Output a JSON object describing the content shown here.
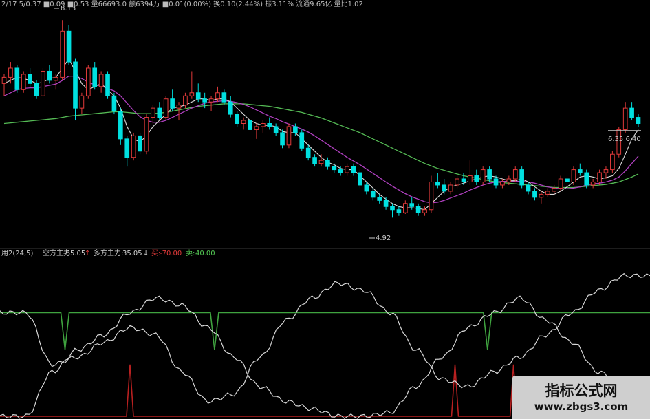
{
  "colors": {
    "up": "#e23a3a",
    "down": "#00e0e0",
    "ma_white": "#dddddd",
    "ma_purple": "#b040c0",
    "ma_green": "#55bb55",
    "ind_white": "#d8d8d8",
    "ind_green": "#3fa33f",
    "ind_red": "#b82020",
    "separator": "#3a3a3a"
  },
  "price_header": {
    "text": "2/17 5/0.37 ■0.09 ■0.53 量66693.0 额6394万 ■0.01(0.00%) 换0.10(2.44%) 振3.11% 流通9.65亿 量比1.02"
  },
  "price_annotations": {
    "high": "8.13",
    "low": "4.92",
    "right_pair": "6.35 6.40"
  },
  "indicator_header": {
    "name": "用2(24,5)",
    "short_label": "空方主力:",
    "short_value": "-65.05",
    "short_arrow": "↑",
    "long_label": "多方主力:",
    "long_value": "35.05",
    "long_arrow": "↓",
    "sell_label": "买:",
    "sell_value": "-70.00",
    "buy_label": "卖:",
    "buy_value": "40.00"
  },
  "watermark": {
    "title": "指标公式网",
    "url": "www.zbgs3.com"
  },
  "chart_data": [
    {
      "type": "candlestick",
      "subtitle": "price panel with moving averages",
      "ylim": [
        4.6,
        8.3
      ],
      "candles": [
        [
          7.1,
          7.25,
          6.9,
          7.2
        ],
        [
          7.2,
          7.45,
          7.1,
          7.35
        ],
        [
          7.35,
          7.4,
          6.95,
          7.0
        ],
        [
          7.0,
          7.3,
          6.95,
          7.25
        ],
        [
          7.25,
          7.35,
          7.05,
          7.1
        ],
        [
          7.1,
          7.15,
          6.85,
          6.9
        ],
        [
          6.9,
          7.35,
          6.9,
          7.3
        ],
        [
          7.3,
          7.4,
          7.1,
          7.15
        ],
        [
          7.15,
          7.25,
          7.0,
          7.2
        ],
        [
          7.2,
          8.13,
          7.15,
          7.95
        ],
        [
          7.95,
          8.05,
          7.4,
          7.45
        ],
        [
          7.45,
          7.5,
          6.5,
          6.7
        ],
        [
          6.7,
          6.95,
          6.6,
          6.9
        ],
        [
          6.9,
          7.4,
          6.85,
          7.35
        ],
        [
          7.35,
          7.45,
          7.0,
          7.05
        ],
        [
          7.05,
          7.3,
          6.95,
          7.25
        ],
        [
          7.25,
          7.3,
          6.85,
          6.9
        ],
        [
          6.9,
          6.95,
          6.6,
          6.65
        ],
        [
          6.65,
          6.7,
          6.1,
          6.2
        ],
        [
          6.2,
          6.25,
          5.75,
          5.9
        ],
        [
          5.9,
          6.3,
          5.85,
          6.25
        ],
        [
          6.25,
          6.3,
          5.95,
          6.0
        ],
        [
          6.0,
          6.6,
          5.95,
          6.55
        ],
        [
          6.55,
          6.75,
          6.45,
          6.7
        ],
        [
          6.7,
          6.8,
          6.5,
          6.55
        ],
        [
          6.55,
          6.9,
          6.5,
          6.85
        ],
        [
          6.85,
          7.0,
          6.65,
          6.7
        ],
        [
          6.7,
          6.8,
          6.5,
          6.75
        ],
        [
          6.75,
          6.95,
          6.7,
          6.9
        ],
        [
          6.9,
          7.3,
          6.85,
          6.95
        ],
        [
          6.95,
          7.1,
          6.8,
          6.85
        ],
        [
          6.85,
          6.95,
          6.7,
          6.8
        ],
        [
          6.8,
          6.9,
          6.65,
          6.85
        ],
        [
          6.85,
          7.05,
          6.8,
          6.95
        ],
        [
          6.95,
          7.0,
          6.75,
          6.8
        ],
        [
          6.8,
          6.9,
          6.55,
          6.6
        ],
        [
          6.6,
          6.65,
          6.4,
          6.45
        ],
        [
          6.45,
          6.55,
          6.35,
          6.5
        ],
        [
          6.5,
          6.55,
          6.3,
          6.35
        ],
        [
          6.35,
          6.45,
          6.2,
          6.4
        ],
        [
          6.4,
          6.5,
          6.3,
          6.45
        ],
        [
          6.45,
          6.55,
          6.35,
          6.4
        ],
        [
          6.4,
          6.45,
          6.25,
          6.3
        ],
        [
          6.3,
          6.35,
          6.05,
          6.1
        ],
        [
          6.1,
          6.45,
          6.05,
          6.4
        ],
        [
          6.4,
          6.45,
          6.25,
          6.3
        ],
        [
          6.3,
          6.35,
          6.0,
          6.05
        ],
        [
          6.05,
          6.1,
          5.85,
          5.9
        ],
        [
          5.9,
          5.95,
          5.75,
          5.8
        ],
        [
          5.8,
          5.95,
          5.75,
          5.85
        ],
        [
          5.85,
          5.9,
          5.7,
          5.75
        ],
        [
          5.75,
          5.8,
          5.65,
          5.7
        ],
        [
          5.7,
          5.75,
          5.6,
          5.65
        ],
        [
          5.65,
          5.8,
          5.6,
          5.75
        ],
        [
          5.75,
          5.8,
          5.6,
          5.65
        ],
        [
          5.65,
          5.7,
          5.4,
          5.45
        ],
        [
          5.45,
          5.5,
          5.3,
          5.35
        ],
        [
          5.35,
          5.4,
          5.2,
          5.25
        ],
        [
          5.25,
          5.3,
          5.15,
          5.2
        ],
        [
          5.2,
          5.25,
          5.05,
          5.1
        ],
        [
          5.1,
          5.15,
          4.92,
          5.05
        ],
        [
          5.05,
          5.1,
          4.95,
          5.0
        ],
        [
          5.0,
          5.2,
          4.98,
          5.15
        ],
        [
          5.15,
          5.25,
          5.05,
          5.1
        ],
        [
          5.1,
          5.15,
          4.95,
          5.0
        ],
        [
          5.0,
          5.1,
          4.95,
          5.05
        ],
        [
          5.05,
          5.6,
          5.0,
          5.5
        ],
        [
          5.5,
          5.65,
          5.4,
          5.45
        ],
        [
          5.45,
          5.55,
          5.3,
          5.35
        ],
        [
          5.35,
          5.5,
          5.3,
          5.45
        ],
        [
          5.45,
          5.6,
          5.4,
          5.55
        ],
        [
          5.55,
          5.65,
          5.45,
          5.5
        ],
        [
          5.5,
          5.85,
          5.45,
          5.6
        ],
        [
          5.6,
          5.7,
          5.45,
          5.5
        ],
        [
          5.5,
          5.75,
          5.45,
          5.7
        ],
        [
          5.7,
          5.75,
          5.5,
          5.55
        ],
        [
          5.55,
          5.6,
          5.4,
          5.45
        ],
        [
          5.45,
          5.55,
          5.4,
          5.5
        ],
        [
          5.5,
          5.6,
          5.45,
          5.55
        ],
        [
          5.55,
          5.75,
          5.5,
          5.7
        ],
        [
          5.7,
          5.75,
          5.4,
          5.45
        ],
        [
          5.45,
          5.5,
          5.3,
          5.35
        ],
        [
          5.35,
          5.4,
          5.2,
          5.25
        ],
        [
          5.25,
          5.35,
          5.15,
          5.3
        ],
        [
          5.3,
          5.4,
          5.25,
          5.35
        ],
        [
          5.35,
          5.45,
          5.3,
          5.4
        ],
        [
          5.4,
          5.6,
          5.35,
          5.55
        ],
        [
          5.55,
          5.65,
          5.45,
          5.5
        ],
        [
          5.5,
          5.75,
          5.45,
          5.7
        ],
        [
          5.7,
          5.8,
          5.6,
          5.65
        ],
        [
          5.65,
          5.7,
          5.4,
          5.45
        ],
        [
          5.45,
          5.55,
          5.4,
          5.5
        ],
        [
          5.5,
          5.7,
          5.45,
          5.65
        ],
        [
          5.65,
          5.75,
          5.55,
          5.7
        ],
        [
          5.7,
          6.0,
          5.65,
          5.95
        ],
        [
          5.95,
          6.4,
          5.9,
          6.35
        ],
        [
          6.35,
          6.8,
          6.3,
          6.7
        ],
        [
          6.7,
          6.8,
          6.5,
          6.55
        ],
        [
          6.55,
          6.6,
          6.4,
          6.45
        ]
      ],
      "ma_short": [
        7.1,
        7.15,
        7.2,
        7.18,
        7.15,
        7.1,
        7.12,
        7.18,
        7.2,
        7.35,
        7.5,
        7.3,
        7.1,
        7.0,
        7.05,
        7.1,
        7.0,
        6.9,
        6.7,
        6.4,
        6.2,
        6.15,
        6.25,
        6.4,
        6.5,
        6.6,
        6.7,
        6.72,
        6.75,
        6.8,
        6.85,
        6.85,
        6.82,
        6.85,
        6.85,
        6.8,
        6.7,
        6.6,
        6.5,
        6.45,
        6.42,
        6.42,
        6.4,
        6.32,
        6.3,
        6.3,
        6.2,
        6.1,
        6.0,
        5.9,
        5.82,
        5.78,
        5.72,
        5.7,
        5.7,
        5.6,
        5.5,
        5.4,
        5.3,
        5.22,
        5.15,
        5.1,
        5.08,
        5.08,
        5.07,
        5.05,
        5.15,
        5.25,
        5.35,
        5.42,
        5.45,
        5.48,
        5.52,
        5.55,
        5.58,
        5.6,
        5.58,
        5.55,
        5.52,
        5.52,
        5.55,
        5.5,
        5.42,
        5.35,
        5.3,
        5.3,
        5.35,
        5.42,
        5.5,
        5.58,
        5.6,
        5.58,
        5.55,
        5.57,
        5.6,
        5.72,
        5.95,
        6.2,
        6.35
      ],
      "ma_mid": [
        6.9,
        6.95,
        7.0,
        7.02,
        7.03,
        7.03,
        7.05,
        7.07,
        7.09,
        7.15,
        7.22,
        7.22,
        7.18,
        7.12,
        7.08,
        7.06,
        7.02,
        6.98,
        6.9,
        6.78,
        6.66,
        6.56,
        6.5,
        6.47,
        6.47,
        6.5,
        6.55,
        6.6,
        6.65,
        6.7,
        6.74,
        6.78,
        6.8,
        6.81,
        6.82,
        6.81,
        6.79,
        6.76,
        6.72,
        6.67,
        6.62,
        6.57,
        6.53,
        6.48,
        6.44,
        6.4,
        6.36,
        6.31,
        6.25,
        6.18,
        6.11,
        6.04,
        5.97,
        5.9,
        5.84,
        5.78,
        5.71,
        5.64,
        5.57,
        5.5,
        5.43,
        5.37,
        5.31,
        5.26,
        5.22,
        5.18,
        5.16,
        5.17,
        5.2,
        5.24,
        5.28,
        5.32,
        5.37,
        5.41,
        5.45,
        5.48,
        5.5,
        5.51,
        5.51,
        5.51,
        5.51,
        5.5,
        5.48,
        5.45,
        5.42,
        5.4,
        5.39,
        5.39,
        5.4,
        5.42,
        5.45,
        5.47,
        5.48,
        5.5,
        5.53,
        5.58,
        5.68,
        5.8,
        5.92
      ],
      "ma_long": [
        6.45,
        6.46,
        6.47,
        6.48,
        6.49,
        6.5,
        6.51,
        6.52,
        6.53,
        6.55,
        6.57,
        6.58,
        6.59,
        6.6,
        6.61,
        6.62,
        6.63,
        6.64,
        6.64,
        6.63,
        6.62,
        6.61,
        6.61,
        6.61,
        6.62,
        6.63,
        6.65,
        6.67,
        6.69,
        6.71,
        6.73,
        6.74,
        6.75,
        6.76,
        6.77,
        6.77,
        6.77,
        6.77,
        6.76,
        6.75,
        6.74,
        6.73,
        6.71,
        6.69,
        6.67,
        6.65,
        6.63,
        6.6,
        6.57,
        6.54,
        6.5,
        6.46,
        6.42,
        6.38,
        6.34,
        6.3,
        6.25,
        6.2,
        6.15,
        6.1,
        6.05,
        6.0,
        5.95,
        5.9,
        5.85,
        5.8,
        5.76,
        5.72,
        5.69,
        5.66,
        5.63,
        5.6,
        5.58,
        5.56,
        5.54,
        5.52,
        5.5,
        5.49,
        5.48,
        5.47,
        5.46,
        5.45,
        5.44,
        5.43,
        5.42,
        5.41,
        5.41,
        5.41,
        5.41,
        5.42,
        5.43,
        5.44,
        5.45,
        5.46,
        5.48,
        5.5,
        5.54,
        5.58,
        5.63
      ]
    },
    {
      "type": "line",
      "subtitle": "oscillator panel",
      "ylim": [
        -100,
        100
      ],
      "x": [
        0,
        4,
        8,
        12,
        16,
        20,
        24,
        28,
        32,
        36,
        40,
        44,
        48,
        52,
        56,
        60,
        64,
        68,
        72,
        76,
        80,
        84,
        88,
        92,
        96,
        100
      ],
      "series": [
        {
          "name": "空方主力",
          "values": [
            -100,
            -100,
            -40,
            -10,
            10,
            40,
            60,
            50,
            20,
            -20,
            -60,
            -80,
            -90,
            -100,
            -100,
            -95,
            -60,
            -20,
            20,
            40,
            60,
            30,
            0,
            -40,
            -60,
            -70
          ]
        },
        {
          "name": "多方主力",
          "values": [
            40,
            40,
            -30,
            -20,
            0,
            20,
            10,
            -40,
            -80,
            -70,
            -20,
            30,
            60,
            80,
            70,
            40,
            -10,
            -50,
            -60,
            -40,
            -20,
            10,
            40,
            70,
            90,
            90
          ]
        },
        {
          "name": "卖",
          "values": [
            40,
            40,
            40,
            40,
            40,
            40,
            40,
            40,
            40,
            40,
            40,
            40,
            40,
            40,
            40,
            40,
            40,
            40,
            40,
            40,
            40,
            40,
            40,
            40,
            40,
            40
          ]
        },
        {
          "name": "买",
          "values": [
            -100,
            -100,
            -100,
            -100,
            -100,
            -100,
            -100,
            -100,
            -100,
            -100,
            -100,
            -100,
            -100,
            -100,
            -100,
            -100,
            -100,
            -100,
            -100,
            -100,
            -100,
            -100,
            -100,
            -100,
            -100,
            -100
          ]
        }
      ],
      "green_dips": [
        10,
        33,
        75,
        111
      ],
      "red_spikes": [
        20,
        70,
        79
      ]
    }
  ]
}
